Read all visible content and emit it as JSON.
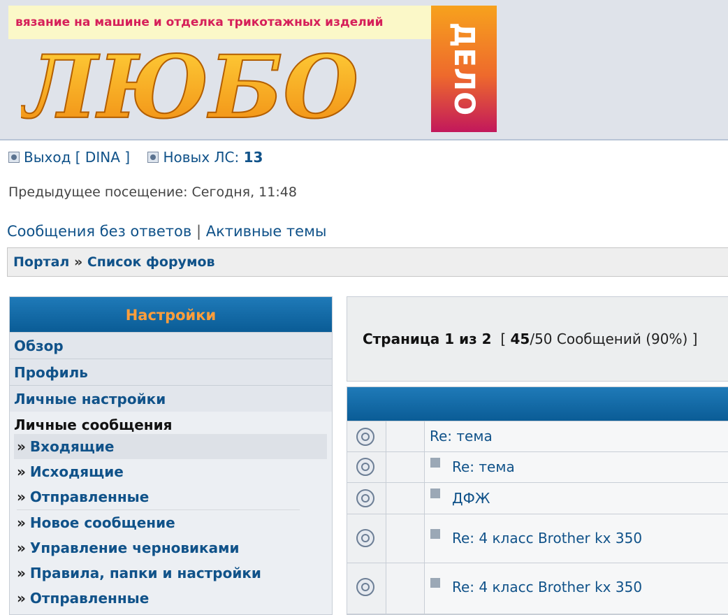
{
  "header": {
    "tagline": "вязание на машине и отделка трикотажных изделий",
    "logo_word": "ЛЮБО",
    "logo_side": "ДЕЛО"
  },
  "user": {
    "logout_label": "Выход [ DINA ]",
    "new_pm_label": "Новых ЛС:",
    "new_pm_count": "13",
    "last_visit": "Предыдущее посещение: Сегодня, 11:48"
  },
  "quicklinks": {
    "unanswered": "Сообщения без ответов",
    "separator": "|",
    "active": "Активные темы"
  },
  "breadcrumb": {
    "portal": "Портал",
    "sep": "»",
    "forums": "Список форумов"
  },
  "sidebar": {
    "title": "Настройки",
    "items": [
      "Обзор",
      "Профиль",
      "Личные настройки"
    ],
    "pm_title": "Личные сообщения",
    "arrow": "»",
    "pm_items": [
      "Входящие",
      "Исходящие",
      "Отправленные"
    ],
    "pm_actions": [
      "Новое сообщение",
      "Управление черновиками",
      "Правила, папки и настройки",
      "Отправленные"
    ]
  },
  "pagination": {
    "page_text": "Страница 1 из 2",
    "open_bracket": "[",
    "count": "45",
    "rest": "/50 Сообщений (90%) ]"
  },
  "messages": [
    {
      "subject": "Re: тема",
      "marked": false
    },
    {
      "subject": "Re: тема",
      "marked": true
    },
    {
      "subject": "ДФЖ",
      "marked": true
    },
    {
      "subject": "Re: 4 класс Brother kx 350",
      "marked": true
    },
    {
      "subject": "Re: 4 класс Brother kx 350",
      "marked": true
    }
  ],
  "colors": {
    "link": "#105289",
    "header_bar": "#0a5c96",
    "sidebar_title": "#ff9e3b",
    "tagline": "#d6205a"
  }
}
